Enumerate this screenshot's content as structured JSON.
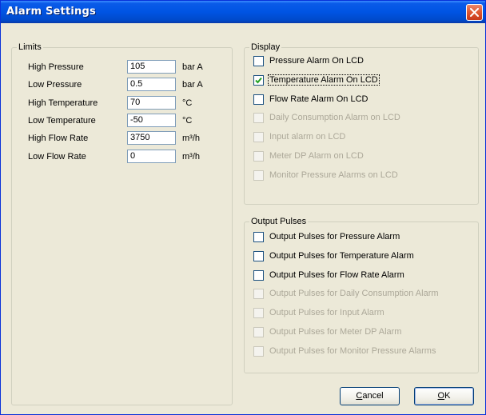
{
  "window": {
    "title": "Alarm Settings"
  },
  "limits": {
    "legend": "Limits",
    "rows": [
      {
        "label": "High Pressure",
        "value": "105",
        "unit": "bar A"
      },
      {
        "label": "Low Pressure",
        "value": "0.5",
        "unit": "bar A"
      },
      {
        "label": "High Temperature",
        "value": "70",
        "unit": "°C"
      },
      {
        "label": "Low Temperature",
        "value": "-50",
        "unit": "°C"
      },
      {
        "label": "High Flow Rate",
        "value": "3750",
        "unit": "m³/h"
      },
      {
        "label": "Low Flow Rate",
        "value": "0",
        "unit": "m³/h"
      }
    ]
  },
  "display": {
    "legend": "Display",
    "items": [
      {
        "label": "Pressure Alarm On LCD",
        "checked": false,
        "enabled": true
      },
      {
        "label": "Temperature Alarm On LCD",
        "checked": true,
        "enabled": true
      },
      {
        "label": "Flow Rate Alarm On LCD",
        "checked": false,
        "enabled": true
      },
      {
        "label": "Daily Consumption Alarm on LCD",
        "checked": false,
        "enabled": false
      },
      {
        "label": "Input alarm on LCD",
        "checked": false,
        "enabled": false
      },
      {
        "label": "Meter DP Alarm on LCD",
        "checked": false,
        "enabled": false
      },
      {
        "label": "Monitor Pressure Alarms on LCD",
        "checked": false,
        "enabled": false
      }
    ]
  },
  "output_pulses": {
    "legend": "Output Pulses",
    "items": [
      {
        "label": "Output Pulses for Pressure Alarm",
        "checked": false,
        "enabled": true
      },
      {
        "label": "Output Pulses for Temperature Alarm",
        "checked": false,
        "enabled": true
      },
      {
        "label": "Output Pulses for Flow Rate Alarm",
        "checked": false,
        "enabled": true
      },
      {
        "label": "Output Pulses for Daily Consumption Alarm",
        "checked": false,
        "enabled": false
      },
      {
        "label": "Output Pulses for Input Alarm",
        "checked": false,
        "enabled": false
      },
      {
        "label": "Output Pulses for Meter DP Alarm",
        "checked": false,
        "enabled": false
      },
      {
        "label": "Output Pulses for Monitor Pressure Alarms",
        "checked": false,
        "enabled": false
      }
    ]
  },
  "buttons": {
    "cancel": {
      "accel": "C",
      "rest": "ancel"
    },
    "ok": {
      "accel": "O",
      "rest": "K"
    }
  },
  "colors": {
    "titlebar": "#0054e3",
    "dialog_bg": "#ece9d8",
    "close_button": "#e05a33",
    "disabled_text": "#aca899"
  },
  "icons": {
    "close": "close-icon",
    "check": "checkmark-icon"
  }
}
